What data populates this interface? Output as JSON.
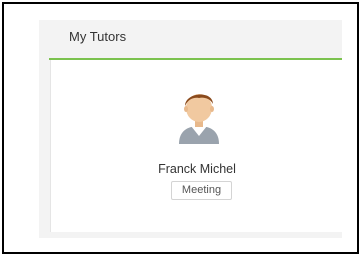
{
  "card": {
    "title": "My Tutors",
    "accent_color": "#7bc24e"
  },
  "tutors": [
    {
      "name": "Franck Michel",
      "action_label": "Meeting",
      "avatar_icon": "user-avatar-icon"
    }
  ]
}
